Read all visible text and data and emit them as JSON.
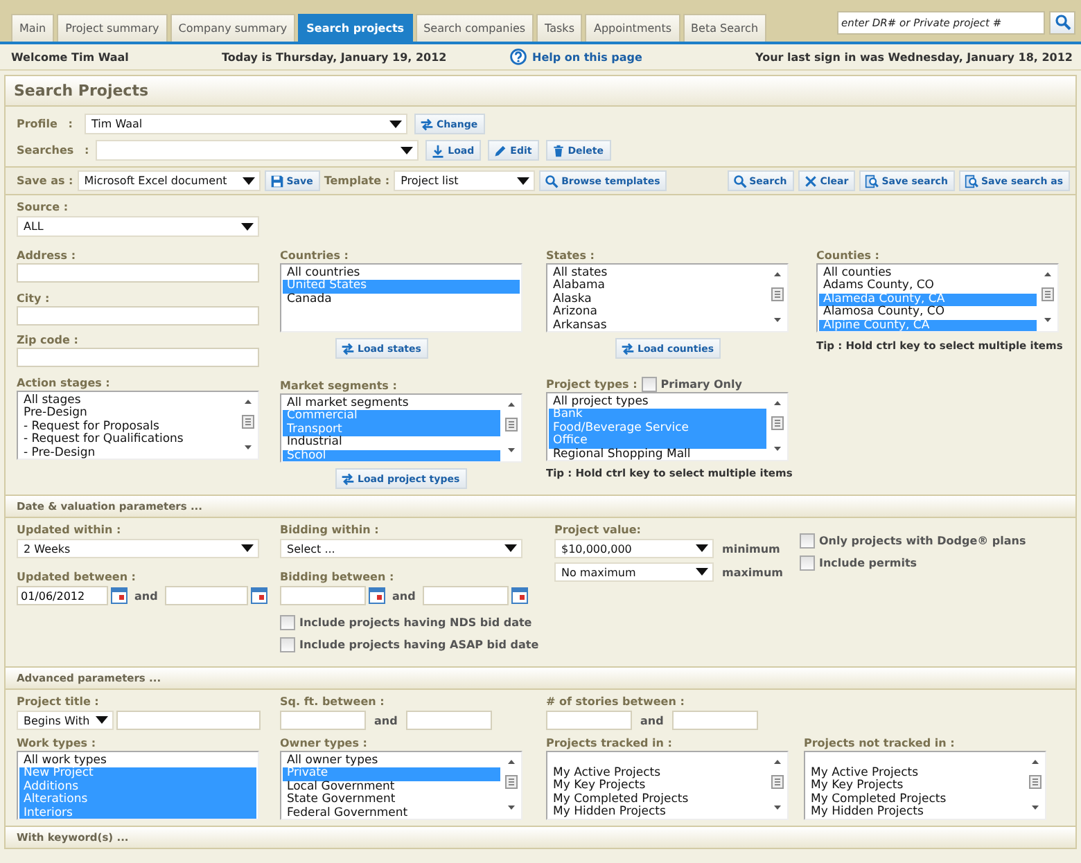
{
  "tabs": [
    {
      "label": "Main",
      "selected": false
    },
    {
      "label": "Project summary",
      "selected": false
    },
    {
      "label": "Company summary",
      "selected": false
    },
    {
      "label": "Search projects",
      "selected": true
    },
    {
      "label": "Search companies",
      "selected": false
    },
    {
      "label": "Tasks",
      "selected": false
    },
    {
      "label": "Appointments",
      "selected": false
    },
    {
      "label": "Beta Search",
      "selected": false
    }
  ],
  "quick_search": {
    "placeholder": "enter DR# or Private project #"
  },
  "info_bar": {
    "welcome": "Welcome Tim Waal",
    "today": "Today is Thursday, January 19, 2012",
    "help_link": "Help on this page",
    "last_sign_in": "Your last sign in was Wednesday, January 18, 2012"
  },
  "panel": {
    "title": "Search Projects"
  },
  "profile": {
    "label": "Profile :",
    "value": "Tim Waal",
    "buttons": [
      {
        "kind": "change",
        "label": "Change"
      }
    ]
  },
  "searches": {
    "label": "Searches :",
    "buttons": [
      {
        "kind": "load",
        "label": "Load"
      },
      {
        "kind": "edit",
        "label": "Edit"
      },
      {
        "kind": "delete",
        "label": "Delete"
      }
    ]
  },
  "toolbar": {
    "save_as_label": "Save as :",
    "save_as_value": "Microsoft Excel document",
    "template_label": "Template :",
    "template_value": "Project list",
    "buttons": [
      {
        "kind": "save",
        "label": "Save"
      },
      {
        "kind": "browse",
        "label": "Browse templates"
      },
      {
        "kind": "search",
        "label": "Search"
      },
      {
        "kind": "clear",
        "label": "Clear"
      },
      {
        "kind": "save_search",
        "label": "Save search"
      },
      {
        "kind": "save_search_as",
        "label": "Save search as"
      }
    ]
  },
  "location": {
    "source": {
      "label": "Source :",
      "value": "ALL"
    },
    "address": {
      "label": "Address :"
    },
    "city": {
      "label": "City :"
    },
    "zip_code": {
      "label": "Zip code :"
    },
    "countries": {
      "label": "Countries :",
      "scrollable": false,
      "items": [
        {
          "label": "All countries",
          "selected": false
        },
        {
          "label": "United States",
          "selected": true
        },
        {
          "label": "Canada",
          "selected": false
        }
      ]
    },
    "load_states": "Load states",
    "states": {
      "label": "States :",
      "scrollable": true,
      "items": [
        {
          "label": "All states",
          "selected": false
        },
        {
          "label": "Alabama",
          "selected": false
        },
        {
          "label": "Alaska",
          "selected": false
        },
        {
          "label": "Arizona",
          "selected": false
        },
        {
          "label": "Arkansas",
          "selected": false
        }
      ]
    },
    "load_counties": "Load counties",
    "counties": {
      "label": "Counties :",
      "scrollable": true,
      "items": [
        {
          "label": "All counties",
          "selected": false
        },
        {
          "label": "Adams County, CO",
          "selected": false
        },
        {
          "label": "Alameda County, CA",
          "selected": true
        },
        {
          "label": "Alamosa County, CO",
          "selected": false
        },
        {
          "label": "Alpine County, CA",
          "selected": true
        }
      ]
    },
    "counties_tip": "Tip : Hold ctrl key to select multiple items",
    "action_stages": {
      "label": "Action stages :",
      "scrollable": true,
      "items": [
        {
          "label": "All stages",
          "selected": false
        },
        {
          "label": "Pre-Design",
          "selected": false
        },
        {
          "label": "- Request for Proposals",
          "selected": false
        },
        {
          "label": "- Request for Qualifications",
          "selected": false
        },
        {
          "label": "- Pre-Design",
          "selected": false
        }
      ]
    },
    "market_segments": {
      "label": "Market segments :",
      "scrollable": true,
      "items": [
        {
          "label": "All market segments",
          "selected": false
        },
        {
          "label": "Commercial",
          "selected": true
        },
        {
          "label": "Transport",
          "selected": true
        },
        {
          "label": "Industrial",
          "selected": false
        },
        {
          "label": "School",
          "selected": true
        }
      ]
    },
    "load_project_types": "Load project types",
    "project_types": {
      "label": "Project types :",
      "primary_only": {
        "label": "Primary Only",
        "checked": false
      },
      "scrollable": true,
      "items": [
        {
          "label": "All project types",
          "selected": false
        },
        {
          "label": "Bank",
          "selected": true
        },
        {
          "label": "Food/Beverage Service",
          "selected": true
        },
        {
          "label": "Office",
          "selected": true
        },
        {
          "label": "Regional Shopping Mall",
          "selected": false
        }
      ]
    },
    "project_types_tip": "Tip : Hold ctrl key to select multiple items"
  },
  "dates": {
    "title": "Date & valuation parameters ...",
    "updated_within": {
      "label": "Updated within :",
      "value": "2 Weeks"
    },
    "updated_between": {
      "label": "Updated between :",
      "from": "01/06/2012",
      "and": "and"
    },
    "bidding_within": {
      "label": "Bidding within :",
      "value": "Select ..."
    },
    "bidding_between": {
      "label": "Bidding between :",
      "and": "and"
    },
    "include_nds": {
      "label": "Include projects having NDS bid date",
      "checked": false
    },
    "include_asap": {
      "label": "Include projects having ASAP bid date",
      "checked": false
    },
    "project_value": {
      "label": "Project value:",
      "minimum": "$10,000,000",
      "minimum_label": "minimum",
      "maximum": "No maximum",
      "maximum_label": "maximum"
    },
    "dodge_plans": {
      "label": "Only projects with Dodge® plans",
      "checked": false
    },
    "include_permits": {
      "label": "Include permits",
      "checked": false
    }
  },
  "advanced": {
    "title": "Advanced parameters ...",
    "project_title": {
      "label": "Project title :",
      "match": "Begins With"
    },
    "sq_ft": {
      "label": "Sq. ft. between :",
      "and": "and"
    },
    "stories": {
      "label": "# of stories between :",
      "and": "and"
    },
    "work_types": {
      "label": "Work types :",
      "scrollable": false,
      "items": [
        {
          "label": "All work types",
          "selected": false
        },
        {
          "label": "New Project",
          "selected": true
        },
        {
          "label": "Additions",
          "selected": true
        },
        {
          "label": "Alterations",
          "selected": true
        },
        {
          "label": "Interiors",
          "selected": true
        }
      ]
    },
    "owner_types": {
      "label": "Owner types :",
      "scrollable": true,
      "items": [
        {
          "label": "All owner types",
          "selected": false
        },
        {
          "label": "Private",
          "selected": true
        },
        {
          "label": "Local Government",
          "selected": false
        },
        {
          "label": "State Government",
          "selected": false
        },
        {
          "label": "Federal Government",
          "selected": false
        }
      ]
    },
    "tracked_in": {
      "label": "Projects tracked in :",
      "scrollable": true,
      "items": [
        {
          "label": "My Active Projects",
          "selected": false
        },
        {
          "label": "My Key Projects",
          "selected": false
        },
        {
          "label": "My Completed Projects",
          "selected": false
        },
        {
          "label": "My Hidden Projects",
          "selected": false
        }
      ]
    },
    "not_tracked_in": {
      "label": "Projects not tracked in :",
      "scrollable": true,
      "items": [
        {
          "label": "My Active Projects",
          "selected": false
        },
        {
          "label": "My Key Projects",
          "selected": false
        },
        {
          "label": "My Completed Projects",
          "selected": false
        },
        {
          "label": "My Hidden Projects",
          "selected": false
        }
      ]
    }
  },
  "keywords": {
    "title": "With keyword(s) ..."
  }
}
